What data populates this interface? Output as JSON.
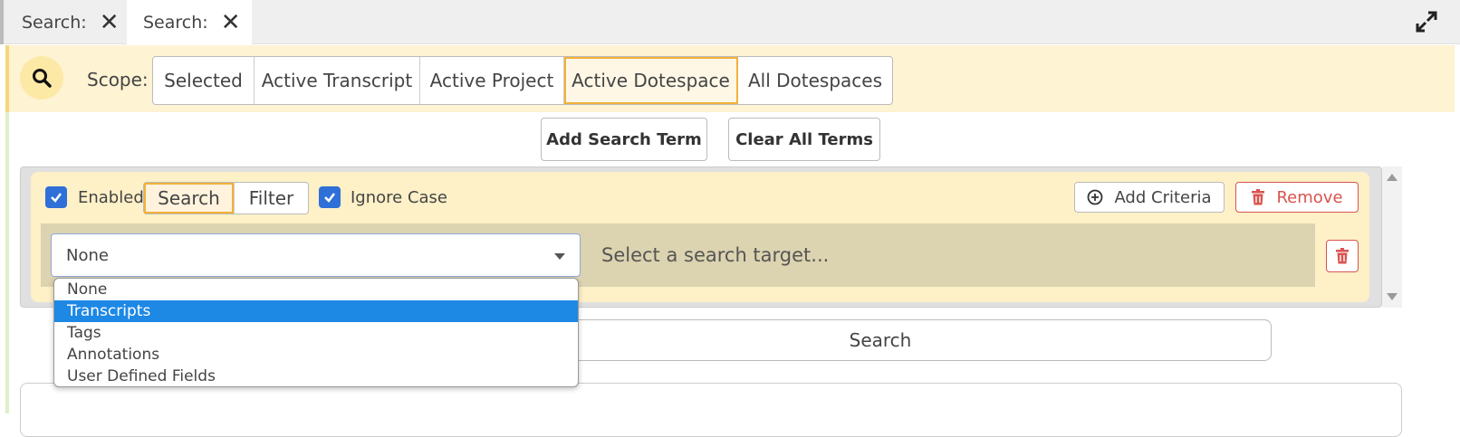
{
  "tabs": [
    {
      "label": "Search:"
    },
    {
      "label": "Search:"
    }
  ],
  "scope": {
    "label": "Scope:",
    "options": [
      "Selected",
      "Active Transcript",
      "Active Project",
      "Active Dotespace",
      "All Dotespaces"
    ],
    "selected": "Active Dotespace"
  },
  "actions": {
    "add_term": "Add Search Term",
    "clear_terms": "Clear All Terms"
  },
  "criteria": {
    "enabled_label": "Enabled",
    "mode_search": "Search",
    "mode_filter": "Filter",
    "mode_selected": "Search",
    "ignore_case_label": "Ignore Case",
    "add_criteria": "Add Criteria",
    "remove": "Remove",
    "target_value": "None",
    "target_hint": "Select a search target...",
    "target_options": [
      "None",
      "Transcripts",
      "Tags",
      "Annotations",
      "User Defined Fields"
    ],
    "target_highlighted": "Transcripts"
  },
  "search_button": "Search",
  "colors": {
    "accent": "#2f6fd8",
    "active_outline": "#f1b13a",
    "danger": "#d9534f",
    "highlight": "#1e88e5"
  }
}
